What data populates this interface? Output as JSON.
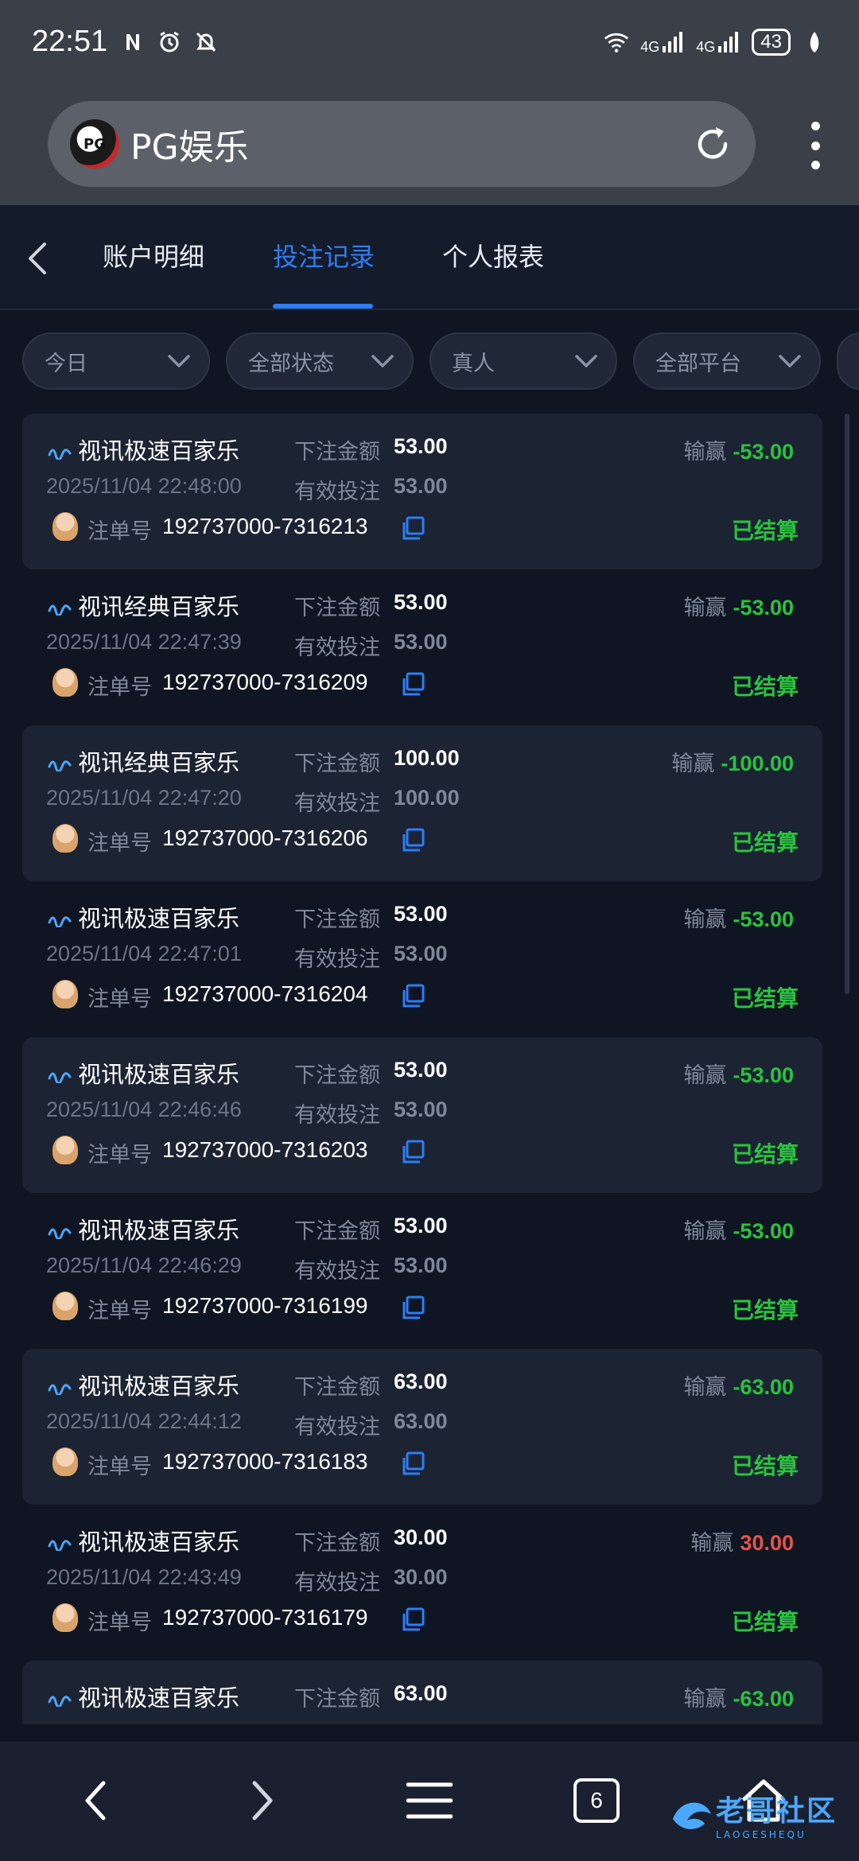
{
  "status_bar": {
    "time": "22:51",
    "network_1": "4G",
    "network_2": "4G",
    "battery": "43"
  },
  "browser": {
    "page_title": "PG娱乐",
    "site_logo_text": "PG"
  },
  "tabs": [
    {
      "label": "账户明细",
      "active": false
    },
    {
      "label": "投注记录",
      "active": true
    },
    {
      "label": "个人报表",
      "active": false
    }
  ],
  "filters": [
    "今日",
    "全部状态",
    "真人",
    "全部平台"
  ],
  "labels": {
    "bet_amount": "下注金额",
    "valid_bet": "有效投注",
    "order_no": "注单号",
    "win_loss": "输赢"
  },
  "records": [
    {
      "game": "视讯极速百家乐",
      "bet": "53.00",
      "datetime": "2025/11/04 22:48:00",
      "valid": "53.00",
      "order": "192737000-7316213",
      "winloss": "-53.00",
      "status": "已结算"
    },
    {
      "game": "视讯经典百家乐",
      "bet": "53.00",
      "datetime": "2025/11/04 22:47:39",
      "valid": "53.00",
      "order": "192737000-7316209",
      "winloss": "-53.00",
      "status": "已结算"
    },
    {
      "game": "视讯经典百家乐",
      "bet": "100.00",
      "datetime": "2025/11/04 22:47:20",
      "valid": "100.00",
      "order": "192737000-7316206",
      "winloss": "-100.00",
      "status": "已结算"
    },
    {
      "game": "视讯极速百家乐",
      "bet": "53.00",
      "datetime": "2025/11/04 22:47:01",
      "valid": "53.00",
      "order": "192737000-7316204",
      "winloss": "-53.00",
      "status": "已结算"
    },
    {
      "game": "视讯极速百家乐",
      "bet": "53.00",
      "datetime": "2025/11/04 22:46:46",
      "valid": "53.00",
      "order": "192737000-7316203",
      "winloss": "-53.00",
      "status": "已结算"
    },
    {
      "game": "视讯极速百家乐",
      "bet": "53.00",
      "datetime": "2025/11/04 22:46:29",
      "valid": "53.00",
      "order": "192737000-7316199",
      "winloss": "-53.00",
      "status": "已结算"
    },
    {
      "game": "视讯极速百家乐",
      "bet": "63.00",
      "datetime": "2025/11/04 22:44:12",
      "valid": "63.00",
      "order": "192737000-7316183",
      "winloss": "-63.00",
      "status": "已结算"
    },
    {
      "game": "视讯极速百家乐",
      "bet": "30.00",
      "datetime": "2025/11/04 22:43:49",
      "valid": "30.00",
      "order": "192737000-7316179",
      "winloss": "30.00",
      "status": "已结算"
    },
    {
      "game": "视讯极速百家乐",
      "bet": "63.00",
      "datetime": "",
      "valid": "",
      "order": "",
      "winloss": "-63.00",
      "status": ""
    }
  ],
  "colors": {
    "loss": "#2ac23e",
    "win": "#e5534b",
    "accent": "#2d7df6",
    "settled": "#2ac23e"
  },
  "bottom_nav": {
    "tab_count": "6"
  },
  "watermark": {
    "text": "老哥社区",
    "subtext": "LAOGESHEQU"
  }
}
